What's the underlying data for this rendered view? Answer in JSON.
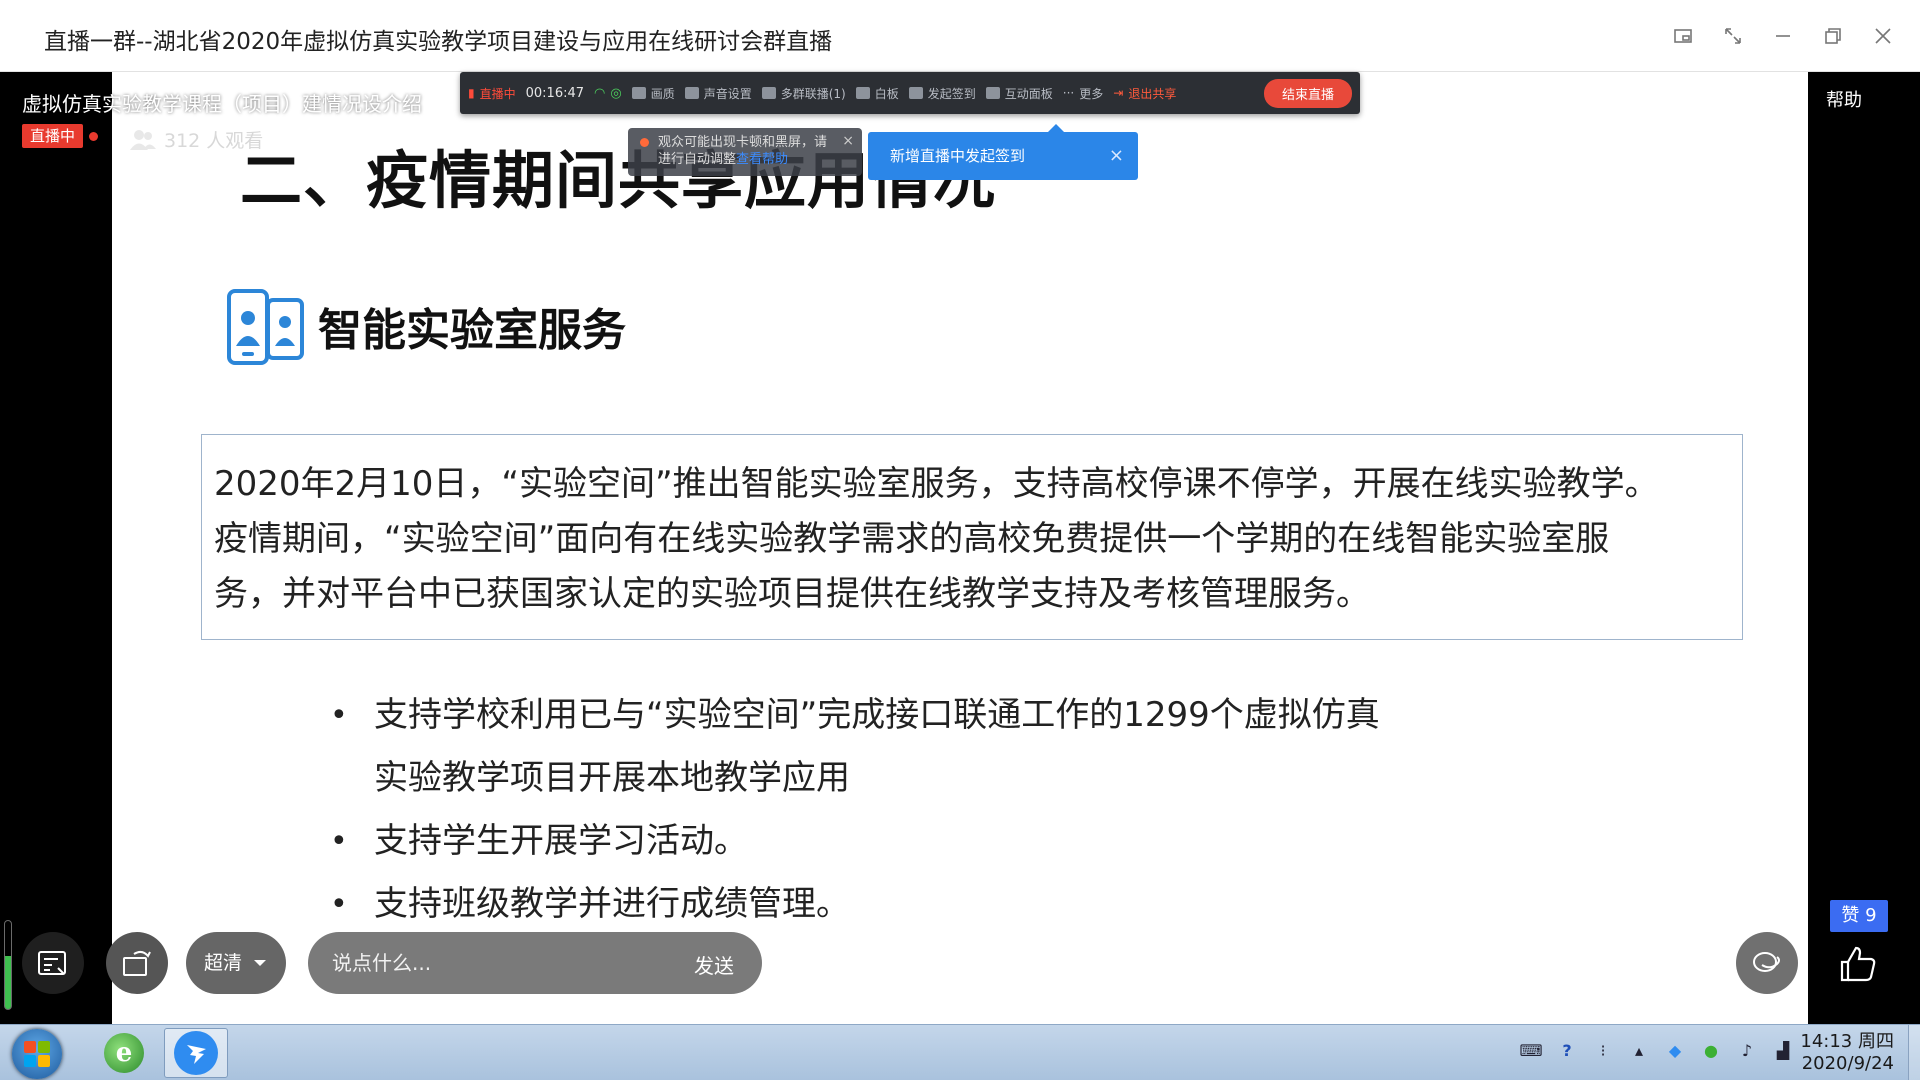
{
  "window": {
    "title": "直播一群--湖北省2020年虚拟仿真实验教学项目建设与应用在线研讨会群直播"
  },
  "live": {
    "title": "虚拟仿真实验教学课程（项目）建情况设介绍",
    "badge": "直播中",
    "viewers": "312 人观看"
  },
  "toolbar": {
    "live_label": "直播中",
    "timer": "00:16:47",
    "items": [
      "画质",
      "声音设置",
      "多群联播(1)",
      "白板",
      "发起签到",
      "互动面板",
      "更多"
    ],
    "exit_share": "退出共享",
    "end_live": "结束直播"
  },
  "popups": {
    "tip_line1": "观众可能出现卡顿和黑屏，请",
    "tip_line2": "进行自动调整",
    "tip_link": "查看帮助",
    "sign_in": "新增直播中发起签到"
  },
  "slide": {
    "heading": "二、疫情期间共享应用情况",
    "section_title": "智能实验室服务",
    "paragraph_lines": [
      "2020年2月10日，“实验空间”推出智能实验室服务，支持高校停课不停学，开展在线实验教学。",
      "疫情期间，“实验空间”面向有在线实验教学需求的高校免费提供一个学期的在线智能实验室服",
      "务，并对平台中已获国家认定的实验项目提供在线教学支持及考核管理服务。"
    ],
    "bullets": [
      "支持学校利用已与“实验空间”完成接口联通工作的1299个虚拟仿真",
      "实验教学项目开展本地教学应用",
      "支持学生开展学习活动。",
      "支持班级教学并进行成绩管理。"
    ]
  },
  "side": {
    "help": "帮助",
    "likes": "赞 9"
  },
  "controls": {
    "quality": "超清",
    "comment_placeholder": "说点什么...",
    "send": "发送"
  },
  "taskbar": {
    "time": "14:13 周四",
    "date": "2020/9/24"
  },
  "colors": {
    "live_red": "#e83a2e",
    "accent_blue": "#2b86e8",
    "likes_blue": "#3b6cf2"
  }
}
